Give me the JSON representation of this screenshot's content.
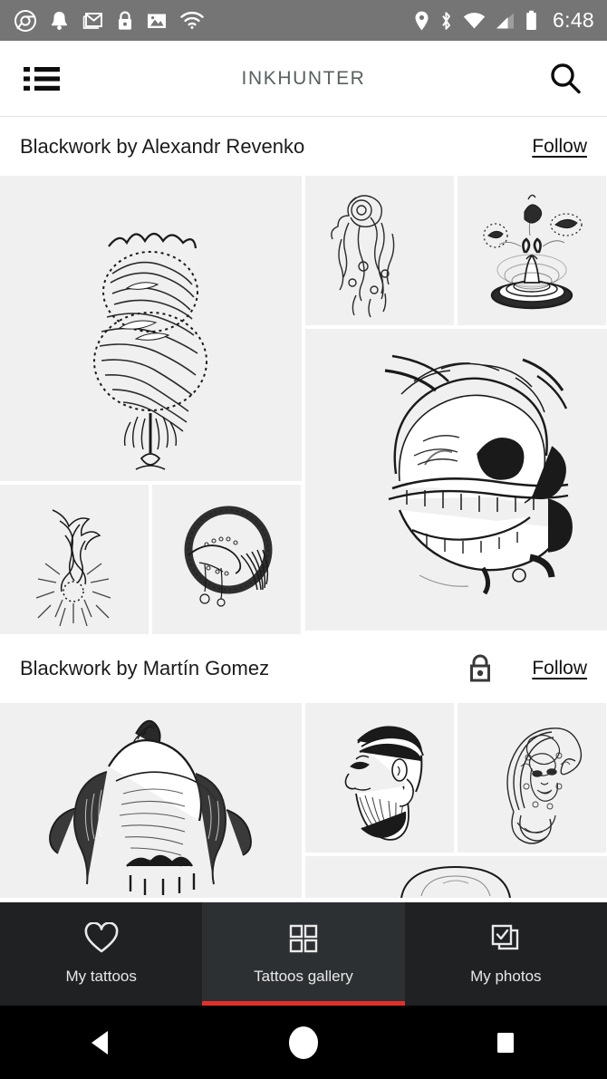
{
  "statusbar": {
    "time": "6:48",
    "left_icons": [
      "chrome-icon",
      "notification-bell-icon",
      "gmail-icon",
      "lock-icon",
      "photo-icon",
      "wifi-icon"
    ],
    "right_icons": [
      "location-pin-icon",
      "bluetooth-icon",
      "wifi-signal-icon",
      "cellular-signal-icon",
      "battery-icon"
    ]
  },
  "appbar": {
    "title": "INKHUNTER",
    "menu_icon": "list-menu-icon",
    "search_icon": "search-icon"
  },
  "sections": [
    {
      "title": "Blackwork by Alexandr Revenko",
      "follow_label": "Follow",
      "locked": false,
      "tiles": [
        {
          "id": "ornate-crowned-beard-portrait",
          "alt": "ornamental crowned bearded figure"
        },
        {
          "id": "floral-phoenix-linework",
          "alt": "floral phoenix linework"
        },
        {
          "id": "figure-with-orbs",
          "alt": "figure on ripples with two orbs"
        },
        {
          "id": "screaming-skull",
          "alt": "screaming skull with flames"
        },
        {
          "id": "serpent-sunburst",
          "alt": "serpent over sunburst rays"
        },
        {
          "id": "raven-wreath-beads",
          "alt": "raven in ring with beads"
        }
      ]
    },
    {
      "title": "Blackwork by Martín Gomez",
      "follow_label": "Follow",
      "locked": true,
      "lock_icon": "padlock-icon",
      "tiles": [
        {
          "id": "winged-creature-torso",
          "alt": "winged creature torso"
        },
        {
          "id": "bearded-man-profile",
          "alt": "bearded man profile"
        },
        {
          "id": "ornamental-mask-paisley",
          "alt": "ornamental paisley mask"
        },
        {
          "id": "dome-sketch",
          "alt": "partial dome sketch"
        }
      ]
    }
  ],
  "bottom_nav": {
    "items": [
      {
        "label": "My tattoos",
        "icon": "heart-icon",
        "active": false
      },
      {
        "label": "Tattoos gallery",
        "icon": "grid-icon",
        "active": true
      },
      {
        "label": "My photos",
        "icon": "checked-photos-icon",
        "active": false
      }
    ],
    "accent_color": "#e0312a",
    "background_color": "#1f2123",
    "active_background_color": "#2d3033"
  },
  "android_nav": {
    "back_icon": "back-triangle-icon",
    "home_icon": "home-circle-icon",
    "recents_icon": "recents-square-icon"
  },
  "colors": {
    "statusbar_bg": "#757575",
    "tile_bg": "#f0f0f0",
    "title_text": "#58605f",
    "accent": "#e0312a"
  }
}
